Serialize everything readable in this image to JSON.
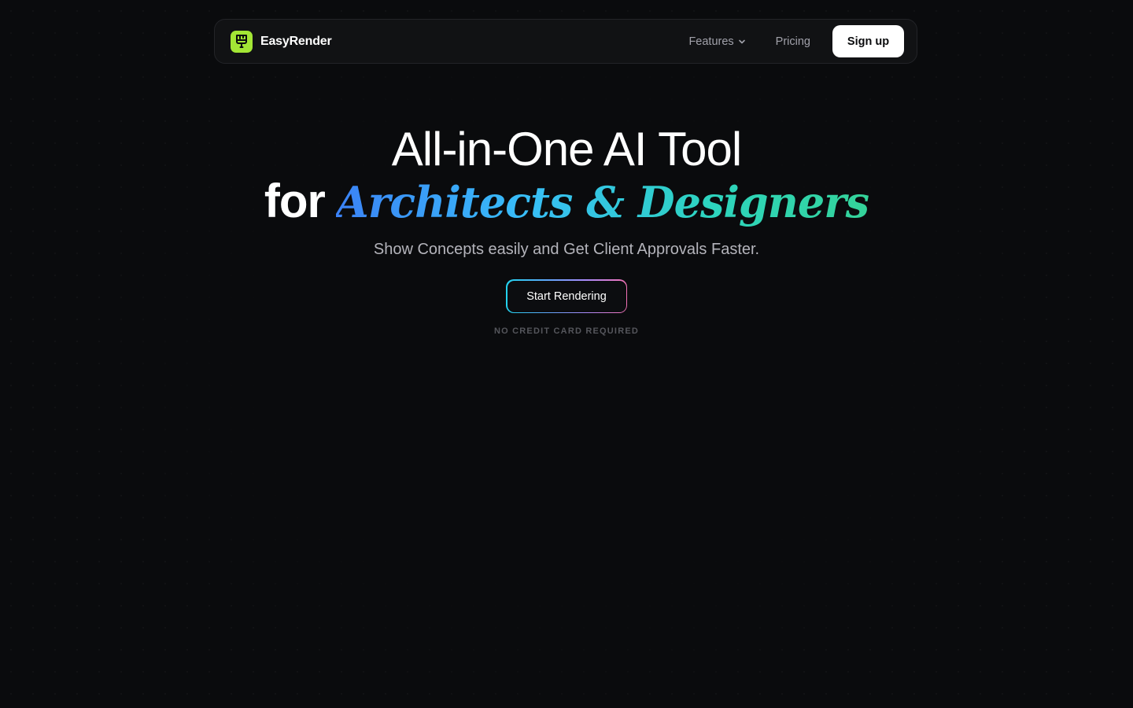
{
  "brand": {
    "name": "EasyRender",
    "logo_icon": "paintbrush-icon",
    "logo_color": "#a3e635"
  },
  "nav": {
    "features_label": "Features",
    "features_icon": "chevron-down-icon",
    "pricing_label": "Pricing",
    "signup_label": "Sign up"
  },
  "hero": {
    "title_line1": "All-in-One AI Tool",
    "title_for": "for",
    "title_script": "Architects & Designers",
    "subtitle": "Show Concepts easily and Get Client Approvals Faster.",
    "cta_label": "Start Rendering",
    "note": "NO CREDIT CARD REQUIRED"
  },
  "colors": {
    "background": "#0a0b0d",
    "script_gradient": [
      "#3b82f6",
      "#38bdf8",
      "#2dd4bf",
      "#34d399"
    ],
    "cta_border_gradient": [
      "#22d3ee",
      "#60a5fa",
      "#a78bfa",
      "#f472b6"
    ]
  }
}
